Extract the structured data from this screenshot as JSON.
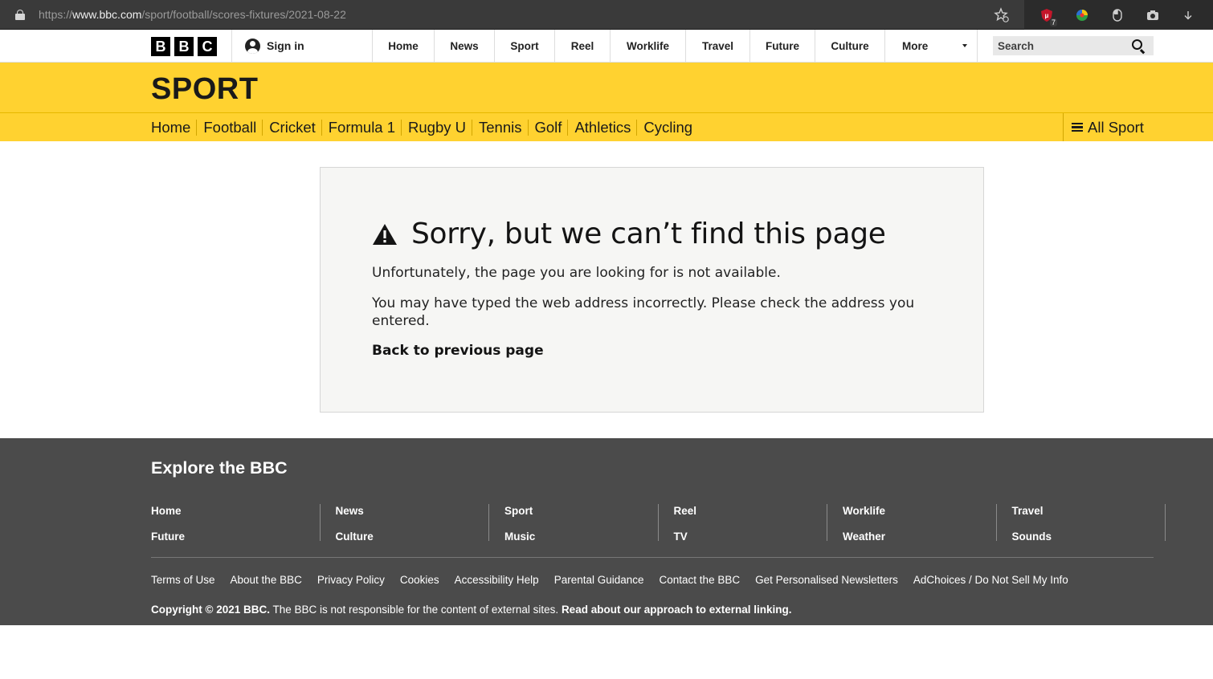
{
  "browser": {
    "url_prefix": "https://",
    "url_domain": "www.bbc.com",
    "url_path": "/sport/football/scores-fixtures/2021-08-22",
    "ext_badge": "7"
  },
  "masthead": {
    "logo_letters": [
      "B",
      "B",
      "C"
    ],
    "signin_label": "Sign in",
    "nav": [
      "Home",
      "News",
      "Sport",
      "Reel",
      "Worklife",
      "Travel",
      "Future",
      "Culture"
    ],
    "more_label": "More",
    "search_placeholder": "Search"
  },
  "sport": {
    "title": "SPORT",
    "nav": [
      "Home",
      "Football",
      "Cricket",
      "Formula 1",
      "Rugby U",
      "Tennis",
      "Golf",
      "Athletics",
      "Cycling"
    ],
    "all_sport_label": "All Sport"
  },
  "error": {
    "title": "Sorry, but we can’t find this page",
    "line1": "Unfortunately, the page you are looking for is not available.",
    "line2": "You may have typed the web address incorrectly. Please check the address you entered.",
    "back_label": "Back to previous page"
  },
  "footer": {
    "title": "Explore the BBC",
    "columns": [
      [
        "Home",
        "Future"
      ],
      [
        "News",
        "Culture"
      ],
      [
        "Sport",
        "Music"
      ],
      [
        "Reel",
        "TV"
      ],
      [
        "Worklife",
        "Weather"
      ],
      [
        "Travel",
        "Sounds"
      ]
    ],
    "links": [
      "Terms of Use",
      "About the BBC",
      "Privacy Policy",
      "Cookies",
      "Accessibility Help",
      "Parental Guidance",
      "Contact the BBC",
      "Get Personalised Newsletters",
      "AdChoices / Do Not Sell My Info"
    ],
    "copyright_bold": "Copyright © 2021 BBC.",
    "copyright_text": " The BBC is not responsible for the content of external sites. ",
    "copyright_link": "Read about our approach to external linking."
  },
  "colors": {
    "sport_yellow": "#ffd230",
    "footer_bg": "#4b4b4b",
    "error_bg": "#f6f6f4"
  }
}
